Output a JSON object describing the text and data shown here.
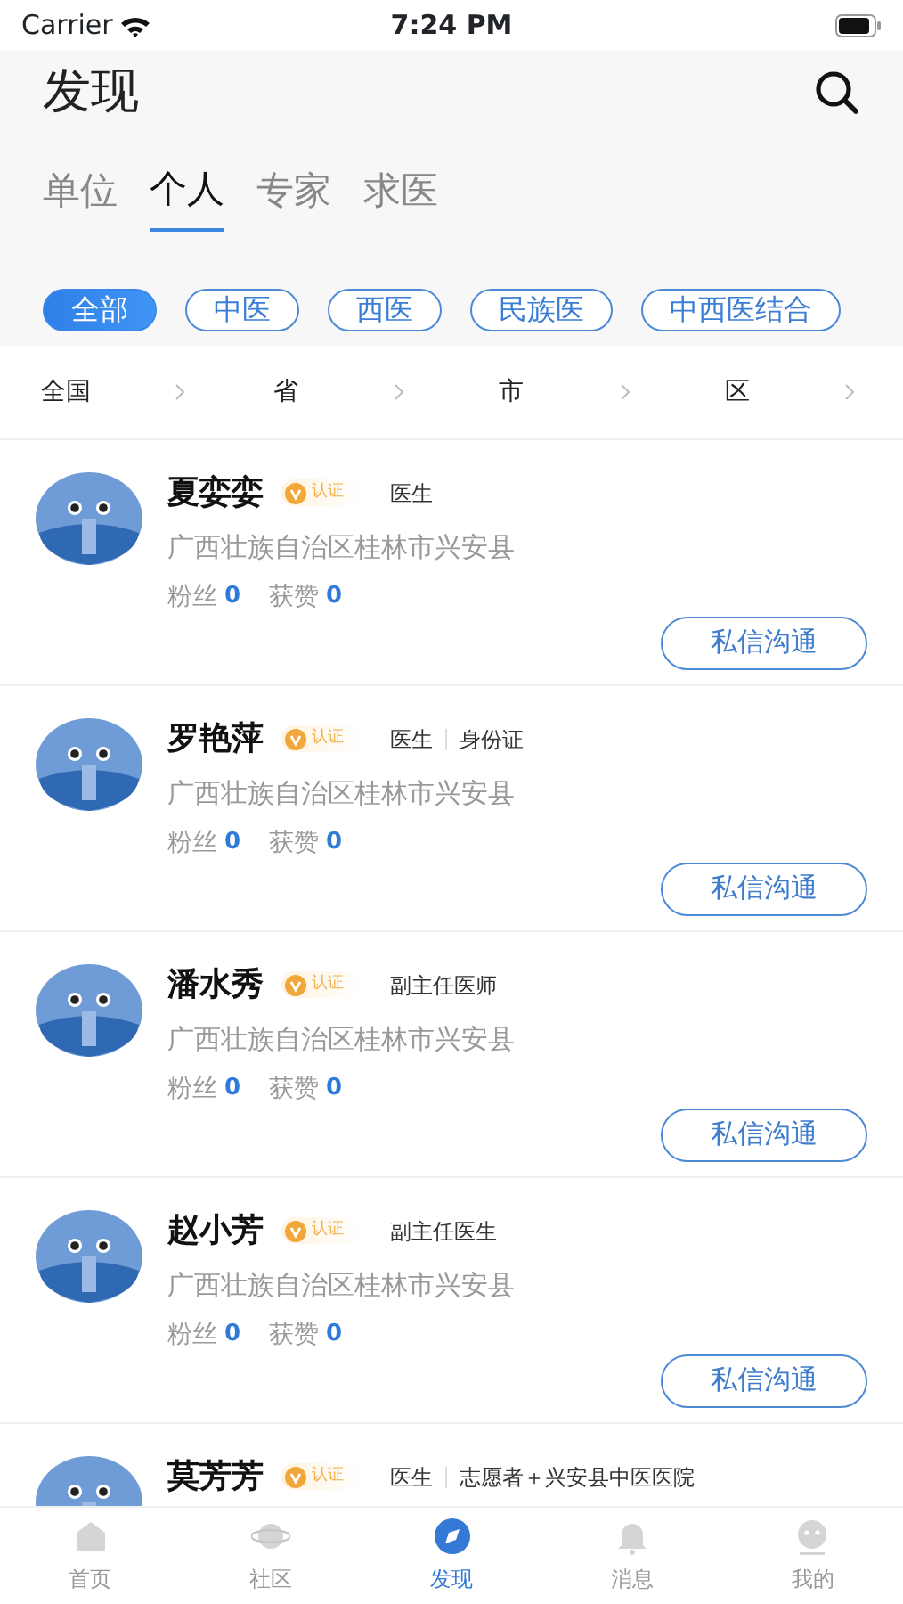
{
  "status_bar": {
    "carrier": "Carrier",
    "time": "7:24 PM"
  },
  "header": {
    "title": "发现"
  },
  "tabs": [
    {
      "label": "单位",
      "selected": false
    },
    {
      "label": "个人",
      "selected": true
    },
    {
      "label": "专家",
      "selected": false
    },
    {
      "label": "求医",
      "selected": false
    }
  ],
  "chips": [
    {
      "label": "全部",
      "selected": true
    },
    {
      "label": "中医",
      "selected": false
    },
    {
      "label": "西医",
      "selected": false
    },
    {
      "label": "民族医",
      "selected": false
    },
    {
      "label": "中西医结合",
      "selected": false
    }
  ],
  "region_filter": [
    "全国",
    "省",
    "市",
    "区"
  ],
  "people": [
    {
      "name": "夏娈娈",
      "badge": "认证",
      "tags": [
        "医生"
      ],
      "address": "广西壮族自治区桂林市兴安县",
      "fans_label": "粉丝",
      "fans": "0",
      "likes_label": "获赞",
      "likes": "0",
      "button": "私信沟通"
    },
    {
      "name": "罗艳萍",
      "badge": "认证",
      "tags": [
        "医生",
        "身份证"
      ],
      "address": "广西壮族自治区桂林市兴安县",
      "fans_label": "粉丝",
      "fans": "0",
      "likes_label": "获赞",
      "likes": "0",
      "button": "私信沟通"
    },
    {
      "name": "潘水秀",
      "badge": "认证",
      "tags": [
        "副主任医师"
      ],
      "address": "广西壮族自治区桂林市兴安县",
      "fans_label": "粉丝",
      "fans": "0",
      "likes_label": "获赞",
      "likes": "0",
      "button": "私信沟通"
    },
    {
      "name": "赵小芳",
      "badge": "认证",
      "tags": [
        "副主任医生"
      ],
      "address": "广西壮族自治区桂林市兴安县",
      "fans_label": "粉丝",
      "fans": "0",
      "likes_label": "获赞",
      "likes": "0",
      "button": "私信沟通"
    },
    {
      "name": "莫芳芳",
      "badge": "认证",
      "tags": [
        "医生",
        "志愿者＋兴安县中医医院"
      ]
    }
  ],
  "bottom_nav": [
    {
      "label": "首页",
      "kind": "home",
      "selected": false
    },
    {
      "label": "社区",
      "kind": "planet",
      "selected": false
    },
    {
      "label": "发现",
      "kind": "compass",
      "selected": true
    },
    {
      "label": "消息",
      "kind": "bell",
      "selected": false
    },
    {
      "label": "我的",
      "kind": "face",
      "selected": false
    }
  ]
}
